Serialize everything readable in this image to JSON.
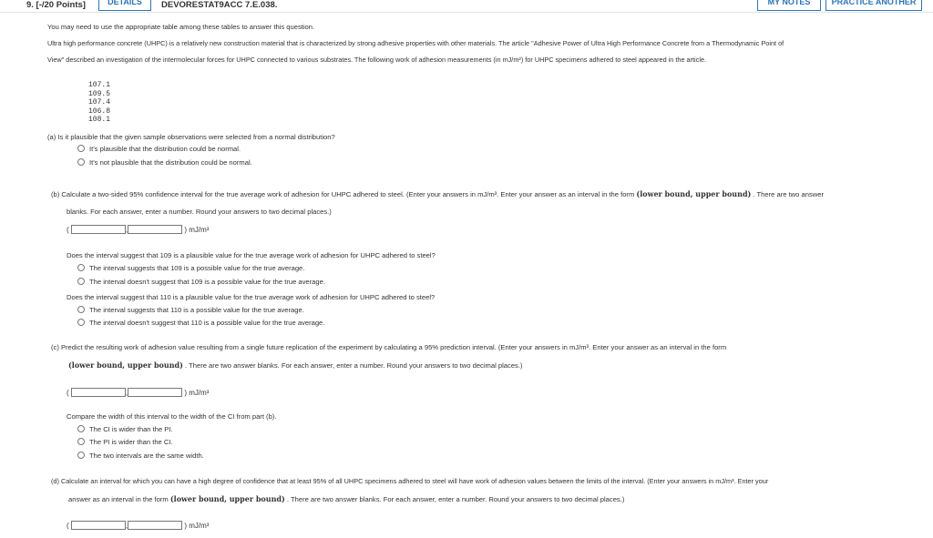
{
  "header": {
    "question_number": "9. [-/20 Points]",
    "details_label": "DETAILS",
    "problem_code": "DEVORESTAT9ACC 7.E.038.",
    "my_notes_label": "MY NOTES",
    "practice_label": "PRACTICE ANOTHER"
  },
  "intro": {
    "line0": "You may need to use the appropriate table among these tables to answer this question.",
    "line1": "Ultra high performance concrete (UHPC) is a relatively new construction material that is characterized by strong adhesive properties with other materials. The article \"Adhesive Power of Ultra High Performance Concrete from a Thermodynamic Point of",
    "line2": "View\" described an investigation of the intermolecular forces for UHPC connected to various substrates. The following work of adhesion measurements (in mJ/m²) for UHPC specimens adhered to steel appeared in the article."
  },
  "data_values": [
    "107.1",
    "109.5",
    "107.4",
    "106.8",
    "108.1"
  ],
  "part_a": {
    "question": "(a)  Is it plausible that the given sample observations were selected from a normal distribution?",
    "options": [
      "It's plausible that the distribution could be normal.",
      "It's not plausible that the distribution could be normal."
    ]
  },
  "part_b": {
    "line1": "(b)  Calculate a two-sided 95% confidence interval for the true average work of adhesion for UHPC adhered to steel. (Enter your answers in mJ/m³. Enter your answer as an interval in the form",
    "form_text": "(lower bound, upper bound)",
    "line1_tail": ". There are two answer",
    "line2": "blanks. For each answer, enter a number. Round your answers to two decimal places.)",
    "unit": ") mJ/m³",
    "q109": "Does the interval suggest that 109 is a plausible value for the true average work of adhesion for UHPC adhered to steel?",
    "q109_options": [
      "The interval suggests that 109 is a possible value for the true average.",
      "The interval doesn't suggest that 109 is a possible value for the true average."
    ],
    "q110": "Does the interval suggest that 110 is a plausible value for the true average work of adhesion for UHPC adhered to steel?",
    "q110_options": [
      "The interval suggests that 110 is a possible value for the true average.",
      "The interval doesn't suggest that 110 is a possible value for the true average."
    ]
  },
  "part_c": {
    "line1": "(c)  Predict the resulting work of adhesion value resulting from a single future replication of the experiment by calculating a 95% prediction interval. (Enter your answers in mJ/m³. Enter your answer as an interval in the form",
    "form_text": "(lower bound, upper bound)",
    "line2_tail": ". There are two answer blanks. For each answer, enter a number. Round your answers to two decimal places.)",
    "unit": ") mJ/m³",
    "compare": "Compare the width of this interval to the width of the CI from part (b).",
    "options": [
      "The CI is wider than the PI.",
      "The PI is wider than the CI.",
      "The two intervals are the same width."
    ]
  },
  "part_d": {
    "line1": "(d)  Calculate an interval for which you can have a high degree of confidence that at least 95% of all UHPC specimens adhered to steel will have work of adhesion values between the limits of the interval. (Enter your answers in mJ/m³. Enter your",
    "line2_head": "answer as an interval in the form",
    "form_text": "(lower bound, upper bound)",
    "line2_tail": ". There are two answer blanks. For each answer, enter a number. Round your answers to two decimal places.)",
    "unit": ") mJ/m³"
  }
}
